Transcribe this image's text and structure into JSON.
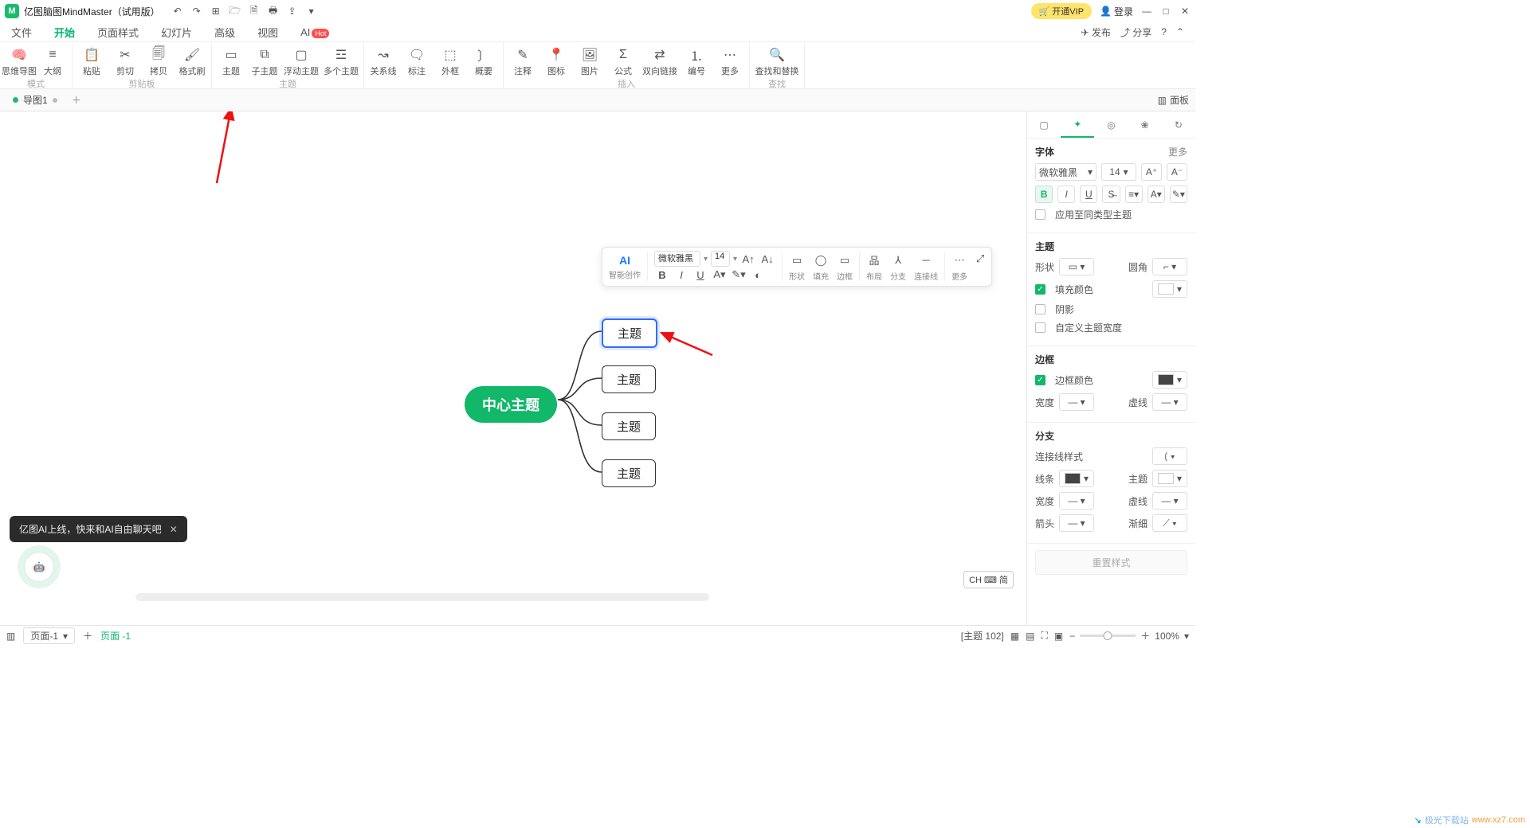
{
  "app": {
    "title": "亿图脑图MindMaster（试用版）"
  },
  "qat": {
    "undo": "↶",
    "redo": "↷",
    "new": "⊞",
    "open": "🗁",
    "save": "🗎",
    "print": "🖶",
    "export": "⇪",
    "exportDrop": "▾"
  },
  "titleRight": {
    "vip": "开通VIP",
    "login": "登录",
    "min": "—",
    "max": "□",
    "close": "✕"
  },
  "menu": {
    "file": "文件",
    "home": "开始",
    "page": "页面样式",
    "slide": "幻灯片",
    "adv": "高级",
    "view": "视图",
    "ai": "AI",
    "hot": "Hot",
    "publish": "发布",
    "share": "分享"
  },
  "ribbon": {
    "mode": {
      "mindmap": "思维导图",
      "outline": "大纲",
      "group": "模式"
    },
    "clip": {
      "paste": "粘贴",
      "cut": "剪切",
      "copy": "拷贝",
      "format": "格式刷",
      "group": "剪贴板"
    },
    "topic": {
      "topic": "主题",
      "sub": "子主题",
      "float": "浮动主题",
      "multi": "多个主题",
      "group": "主题"
    },
    "rel": {
      "rel": "关系线",
      "callout": "标注",
      "boundary": "外框",
      "summary": "概要"
    },
    "insert": {
      "note": "注释",
      "icon": "图标",
      "image": "图片",
      "formula": "公式",
      "link": "双向链接",
      "number": "编号",
      "more": "更多",
      "group": "插入"
    },
    "find": {
      "find": "查找和替换",
      "group": "查找"
    }
  },
  "tabs": {
    "doc": "导图1",
    "panel": "面板"
  },
  "fmt": {
    "ai": "AI",
    "aiLb": "智能创作",
    "font": "微软雅黑",
    "size": "14",
    "shape": "形状",
    "fill": "填充",
    "border": "边框",
    "layout": "布局",
    "branch": "分支",
    "connector": "连接线",
    "more": "更多"
  },
  "mindmap": {
    "center": "中心主题",
    "topics": [
      "主题",
      "主题",
      "主题",
      "主题"
    ]
  },
  "toast": {
    "text": "亿图AI上线，快来和AI自由聊天吧"
  },
  "rpanel": {
    "font": {
      "hd": "字体",
      "more": "更多",
      "family": "微软雅黑",
      "size": "14",
      "applySame": "应用至同类型主题"
    },
    "theme": {
      "hd": "主题",
      "shape": "形状",
      "radius": "圆角",
      "fill": "填充颜色",
      "shadow": "阴影",
      "custom": "自定义主题宽度"
    },
    "border": {
      "hd": "边框",
      "color": "边框颜色",
      "width": "宽度",
      "dash": "虚线"
    },
    "branch": {
      "hd": "分支",
      "conn": "连接线样式",
      "line": "线条",
      "theme": "主题",
      "width": "宽度",
      "dash": "虚线",
      "arrow": "箭头",
      "taper": "渐细"
    },
    "reset": "重置样式"
  },
  "status": {
    "page": "页面-1",
    "pageLb": "页面 -1",
    "topicCount": "[主题 102]",
    "zoom": "100%"
  },
  "ime": {
    "text": "CH ⌨ 简"
  },
  "watermark": {
    "brand": "极光下载站",
    "url": "www.xz7.com"
  }
}
